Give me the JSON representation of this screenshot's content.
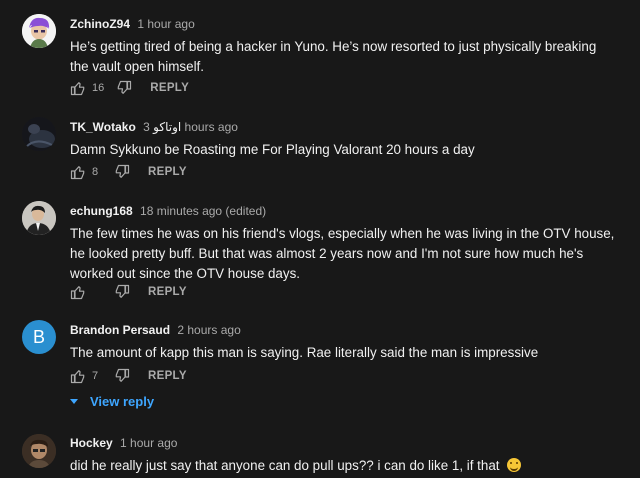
{
  "comments": [
    {
      "author": "ZchinoZ94",
      "time": "1 hour ago",
      "text": "He’s getting tired of being a hacker in Yuno. He’s now resorted to just physically breaking the vault open himself.",
      "likes": "16",
      "reply_label": "REPLY",
      "avatar_icon": "purple-haired-character-avatar"
    },
    {
      "author": "TK_Wotako",
      "author_suffix": "اوتاكو",
      "time": "3 hours ago",
      "text": "Damn Sykkuno be Roasting me For Playing Valorant 20 hours a day",
      "likes": "8",
      "reply_label": "REPLY",
      "avatar_icon": "dark-photo-avatar"
    },
    {
      "author": "echung168",
      "time": "18 minutes ago (edited)",
      "text": "The few times he was on his friend's vlogs, especially when he was living in the OTV house, he looked pretty buff. But that was almost 2 years now and I'm not sure how much he's worked out since the OTV house days.",
      "likes": "",
      "reply_label": "REPLY",
      "avatar_icon": "person-photo-avatar"
    },
    {
      "author": "Brandon Persaud",
      "time": "2 hours ago",
      "text": "The amount of kapp this man is saying. Rae literally said the man is impressive",
      "likes": "7",
      "reply_label": "REPLY",
      "avatar_letter": "B",
      "avatar_color": "#2a8fd0",
      "view_reply": "View reply"
    },
    {
      "author": "Hockey",
      "time": "1 hour ago",
      "text": "did he really just say that anyone can do pull ups?? i can do like 1, if that",
      "emoji": "grinning-face-emoji",
      "avatar_icon": "photo-avatar"
    }
  ]
}
